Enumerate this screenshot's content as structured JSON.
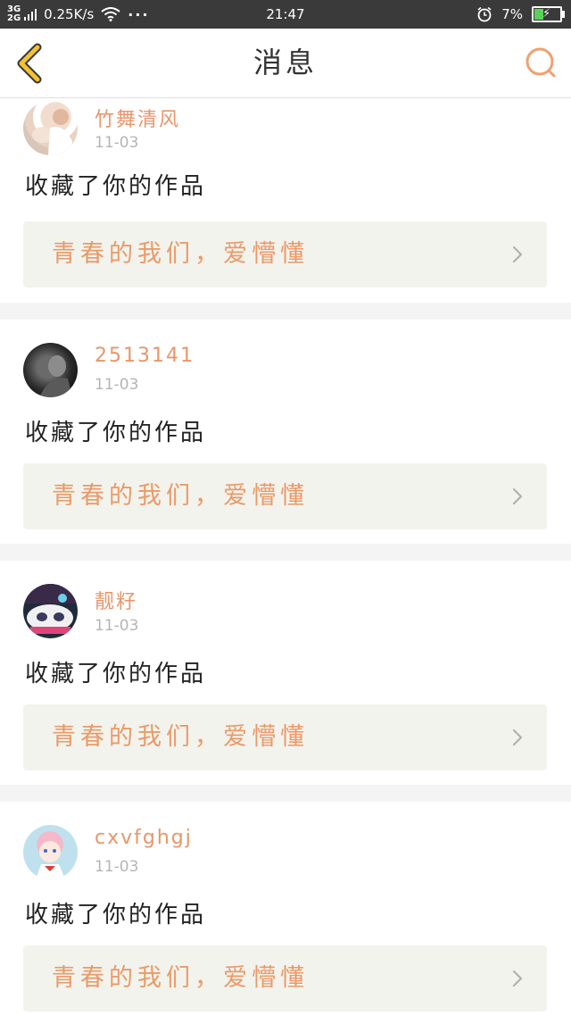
{
  "status_bar": {
    "network_top": "3G",
    "network_bottom": "2G",
    "speed": "0.25K/s",
    "more": "···",
    "time": "21:47",
    "battery": "7%"
  },
  "header": {
    "title": "消息"
  },
  "colors": {
    "accent": "#e9956a",
    "back_icon": "#f2c230",
    "card_bg": "#f3f3ed"
  },
  "messages": [
    {
      "username": "竹舞清风",
      "date": "11-03",
      "action": "收藏了你的作品",
      "work_title": "青春的我们，爱懵懂"
    },
    {
      "username": "2513141",
      "date": "11-03",
      "action": "收藏了你的作品",
      "work_title": "青春的我们，爱懵懂"
    },
    {
      "username": "靓籽",
      "date": "11-03",
      "action": "收藏了你的作品",
      "work_title": "青春的我们，爱懵懂"
    },
    {
      "username": "cxvfghgj",
      "date": "11-03",
      "action": "收藏了你的作品",
      "work_title": "青春的我们，爱懵懂"
    }
  ]
}
